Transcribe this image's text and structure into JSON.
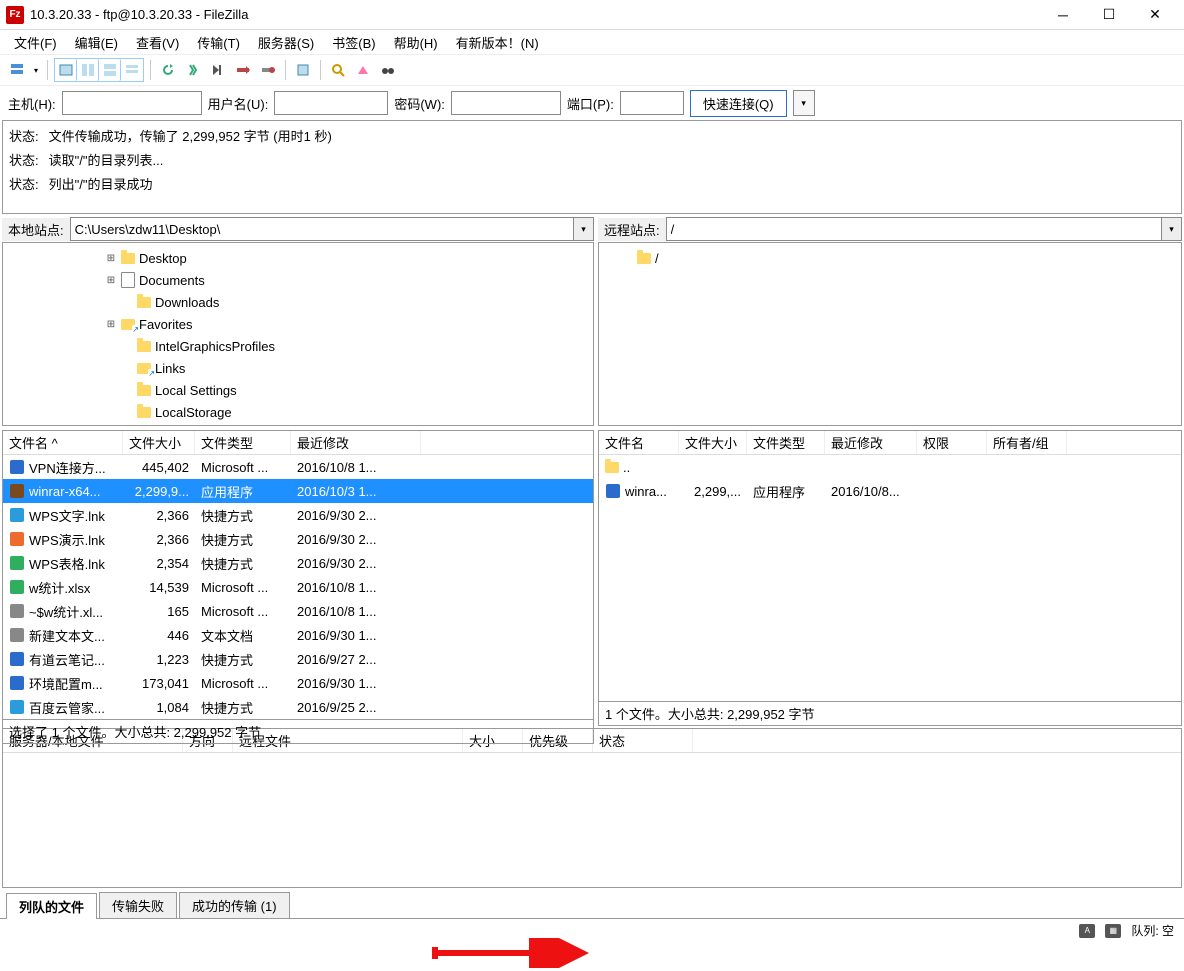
{
  "window": {
    "title": "10.3.20.33 - ftp@10.3.20.33 - FileZilla"
  },
  "menu": [
    "文件(F)",
    "编辑(E)",
    "查看(V)",
    "传输(T)",
    "服务器(S)",
    "书签(B)",
    "帮助(H)",
    "有新版本！(N)"
  ],
  "quickconnect": {
    "host_label": "主机(H):",
    "user_label": "用户名(U):",
    "pass_label": "密码(W):",
    "port_label": "端口(P):",
    "connect_label": "快速连接(Q)",
    "host": "",
    "user": "",
    "pass": "",
    "port": ""
  },
  "log": [
    {
      "label": "状态:",
      "text": "文件传输成功，传输了 2,299,952 字节 (用时1 秒)"
    },
    {
      "label": "状态:",
      "text": "读取\"/\"的目录列表..."
    },
    {
      "label": "状态:",
      "text": "列出\"/\"的目录成功"
    }
  ],
  "local": {
    "site_label": "本地站点:",
    "path": "C:\\Users\\zdw11\\Desktop\\",
    "tree": [
      {
        "indent": 6,
        "exp": "+",
        "icon": "folder",
        "name": "Desktop"
      },
      {
        "indent": 6,
        "exp": "+",
        "icon": "doc",
        "name": "Documents"
      },
      {
        "indent": 7,
        "exp": "",
        "icon": "folder",
        "name": "Downloads"
      },
      {
        "indent": 6,
        "exp": "+",
        "icon": "folder-link",
        "name": "Favorites"
      },
      {
        "indent": 7,
        "exp": "",
        "icon": "folder",
        "name": "IntelGraphicsProfiles"
      },
      {
        "indent": 7,
        "exp": "",
        "icon": "folder-link",
        "name": "Links"
      },
      {
        "indent": 7,
        "exp": "",
        "icon": "folder",
        "name": "Local Settings"
      },
      {
        "indent": 7,
        "exp": "",
        "icon": "folder",
        "name": "LocalStorage"
      }
    ],
    "columns": [
      "文件名 ^",
      "文件大小",
      "文件类型",
      "最近修改"
    ],
    "files": [
      {
        "icon": "#2a6bcc",
        "name": "VPN连接方...",
        "size": "445,402",
        "type": "Microsoft ...",
        "mod": "2016/10/8 1..."
      },
      {
        "icon": "#7a4a1e",
        "name": "winrar-x64...",
        "size": "2,299,9...",
        "type": "应用程序",
        "mod": "2016/10/3 1...",
        "selected": true
      },
      {
        "icon": "#2b9cda",
        "name": "WPS文字.lnk",
        "size": "2,366",
        "type": "快捷方式",
        "mod": "2016/9/30 2..."
      },
      {
        "icon": "#ee6b2f",
        "name": "WPS演示.lnk",
        "size": "2,366",
        "type": "快捷方式",
        "mod": "2016/9/30 2..."
      },
      {
        "icon": "#2fae60",
        "name": "WPS表格.lnk",
        "size": "2,354",
        "type": "快捷方式",
        "mod": "2016/9/30 2..."
      },
      {
        "icon": "#2fae60",
        "name": "w统计.xlsx",
        "size": "14,539",
        "type": "Microsoft ...",
        "mod": "2016/10/8 1..."
      },
      {
        "icon": "#888",
        "name": "~$w统计.xl...",
        "size": "165",
        "type": "Microsoft ...",
        "mod": "2016/10/8 1..."
      },
      {
        "icon": "#888",
        "name": "新建文本文...",
        "size": "446",
        "type": "文本文档",
        "mod": "2016/9/30 1..."
      },
      {
        "icon": "#2a6bcc",
        "name": "有道云笔记...",
        "size": "1,223",
        "type": "快捷方式",
        "mod": "2016/9/27 2..."
      },
      {
        "icon": "#2a6bcc",
        "name": "环境配置m...",
        "size": "173,041",
        "type": "Microsoft ...",
        "mod": "2016/9/30 1..."
      },
      {
        "icon": "#2b9cda",
        "name": "百度云管家...",
        "size": "1,084",
        "type": "快捷方式",
        "mod": "2016/9/25 2..."
      }
    ],
    "status": "选择了 1 个文件。大小总共: 2,299,952 字节"
  },
  "remote": {
    "site_label": "远程站点:",
    "path": "/",
    "tree": [
      {
        "indent": 1,
        "exp": "",
        "icon": "folder",
        "name": "/"
      }
    ],
    "columns": [
      "文件名",
      "文件大小",
      "文件类型",
      "最近修改",
      "权限",
      "所有者/组"
    ],
    "files": [
      {
        "icon": "folder",
        "name": "..",
        "size": "",
        "type": "",
        "mod": ""
      },
      {
        "icon": "#2a6bcc",
        "name": "winra...",
        "size": "2,299,...",
        "type": "应用程序",
        "mod": "2016/10/8..."
      }
    ],
    "status": "1 个文件。大小总共: 2,299,952 字节"
  },
  "queue": {
    "columns": [
      "服务器/本地文件",
      "方向",
      "远程文件",
      "大小",
      "优先级",
      "状态"
    ]
  },
  "tabs": [
    {
      "label": "列队的文件",
      "active": true
    },
    {
      "label": "传输失败",
      "active": false
    },
    {
      "label": "成功的传输 (1)",
      "active": false
    }
  ],
  "statusbar": {
    "queue_label": "队列: 空"
  },
  "colwidths": {
    "local": [
      120,
      72,
      96,
      130
    ],
    "remote": [
      80,
      68,
      78,
      92,
      70,
      80
    ],
    "queue": [
      180,
      50,
      230,
      60,
      70,
      100
    ]
  }
}
